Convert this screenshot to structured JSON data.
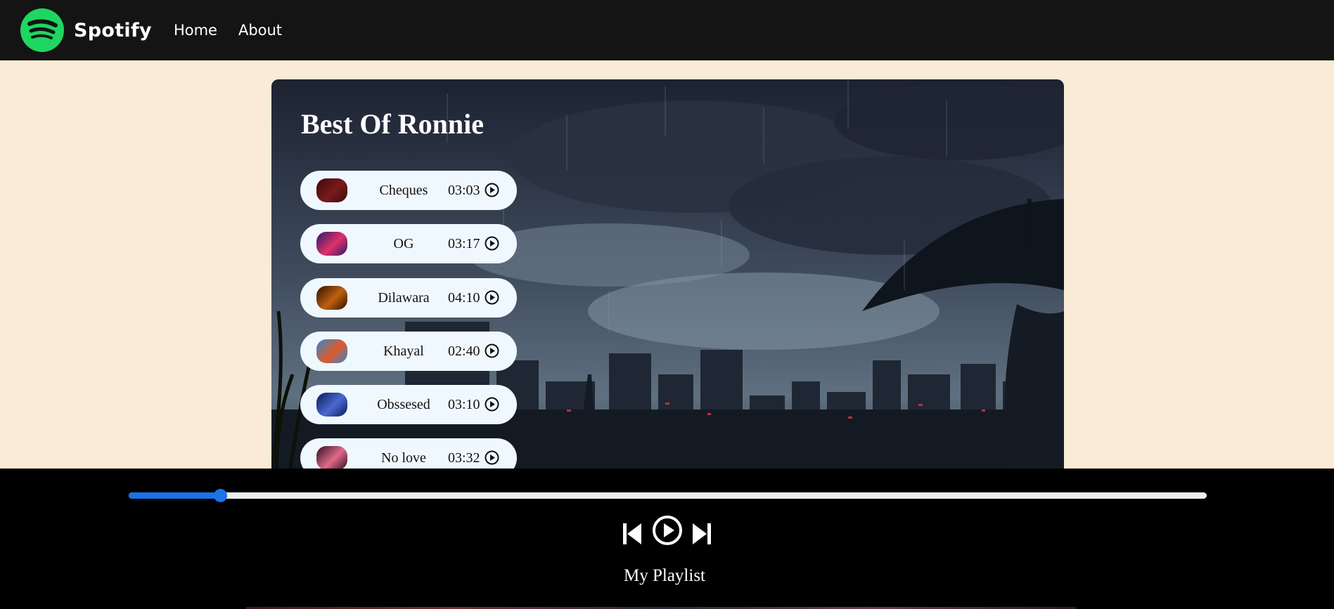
{
  "nav": {
    "brand": "Spotify",
    "links": [
      "Home",
      "About"
    ],
    "logo_color": "#1ed760"
  },
  "playlist": {
    "title": "Best Of Ronnie",
    "songs": [
      {
        "name": "Cheques",
        "duration": "03:03",
        "thumb_colors": [
          "#3a0a0a",
          "#7a1a1a"
        ]
      },
      {
        "name": "OG",
        "duration": "03:17",
        "thumb_colors": [
          "#2a1a6a",
          "#e0306a"
        ]
      },
      {
        "name": "Dilawara",
        "duration": "04:10",
        "thumb_colors": [
          "#2a1200",
          "#c06010"
        ]
      },
      {
        "name": "Khayal",
        "duration": "02:40",
        "thumb_colors": [
          "#2a8ad0",
          "#e05a2a"
        ]
      },
      {
        "name": "Obssesed",
        "duration": "03:10",
        "thumb_colors": [
          "#0a1a5a",
          "#4a6ad0"
        ]
      },
      {
        "name": "No love",
        "duration": "03:32",
        "thumb_colors": [
          "#2a1020",
          "#e06a8a"
        ]
      }
    ],
    "play_icon": "play-circle-icon"
  },
  "player": {
    "progress": 0.085,
    "accent_color": "#1a73e8",
    "controls": [
      "previous-icon",
      "play-icon",
      "next-icon"
    ],
    "footer_label": "My Playlist"
  }
}
